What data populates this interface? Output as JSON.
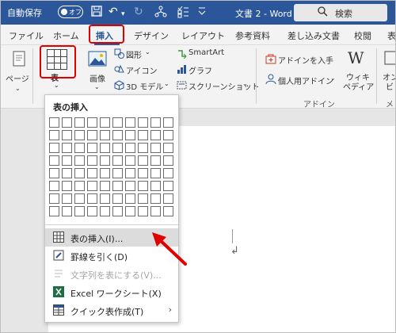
{
  "titlebar": {
    "autosave_label": "自動保存",
    "autosave_state": "オフ",
    "doc_title": "文書 2 - Word",
    "search_placeholder": "検索",
    "icons": [
      "save-icon",
      "undo-icon",
      "redo-icon",
      "share-icon",
      "checklist-icon",
      "dropdown-icon"
    ]
  },
  "tabs": [
    "ファイル",
    "ホーム",
    "挿入",
    "デザイン",
    "レイアウト",
    "参考資料",
    "差し込み文書",
    "校閲",
    "表"
  ],
  "active_tab": "挿入",
  "ribbon": {
    "page_label": "ページ",
    "table_label": "表",
    "image_label": "画像",
    "shapes_label": "図形",
    "icons_label": "アイコン",
    "model3d_label": "3D モデル",
    "smartart_label": "SmartArt",
    "graph_label": "グラフ",
    "screenshot_label": "スクリーンショット",
    "addin_get_label": "アドインを入手",
    "personal_addin_label": "個人用アドイン",
    "wiki_label_1": "ウィキ",
    "wiki_label_2": "ペディア",
    "online_label_1": "オン",
    "online_label_2": "ビ",
    "addin_group_label": "アドイン",
    "media_group_label": "メデ"
  },
  "dropdown": {
    "header": "表の挿入",
    "grid_cols": 10,
    "grid_rows": 8,
    "items": [
      {
        "label": "表の挿入(I)...",
        "enabled": true,
        "highlighted": true,
        "icon": "table-insert-icon"
      },
      {
        "label": "罫線を引く(D)",
        "enabled": true,
        "highlighted": false,
        "icon": "pencil-icon"
      },
      {
        "label": "文字列を表にする(V)...",
        "enabled": false,
        "highlighted": false,
        "icon": "text-to-table-icon"
      },
      {
        "label": "Excel ワークシート(X)",
        "enabled": true,
        "highlighted": false,
        "icon": "excel-icon"
      },
      {
        "label": "クイック表作成(T)",
        "enabled": true,
        "highlighted": false,
        "icon": "quick-table-icon",
        "submenu": true
      }
    ]
  },
  "colors": {
    "titlebar": "#2b579a",
    "accent": "#2b579a",
    "highlight_red": "#e00000",
    "menu_highlight": "#dcdcdc"
  }
}
